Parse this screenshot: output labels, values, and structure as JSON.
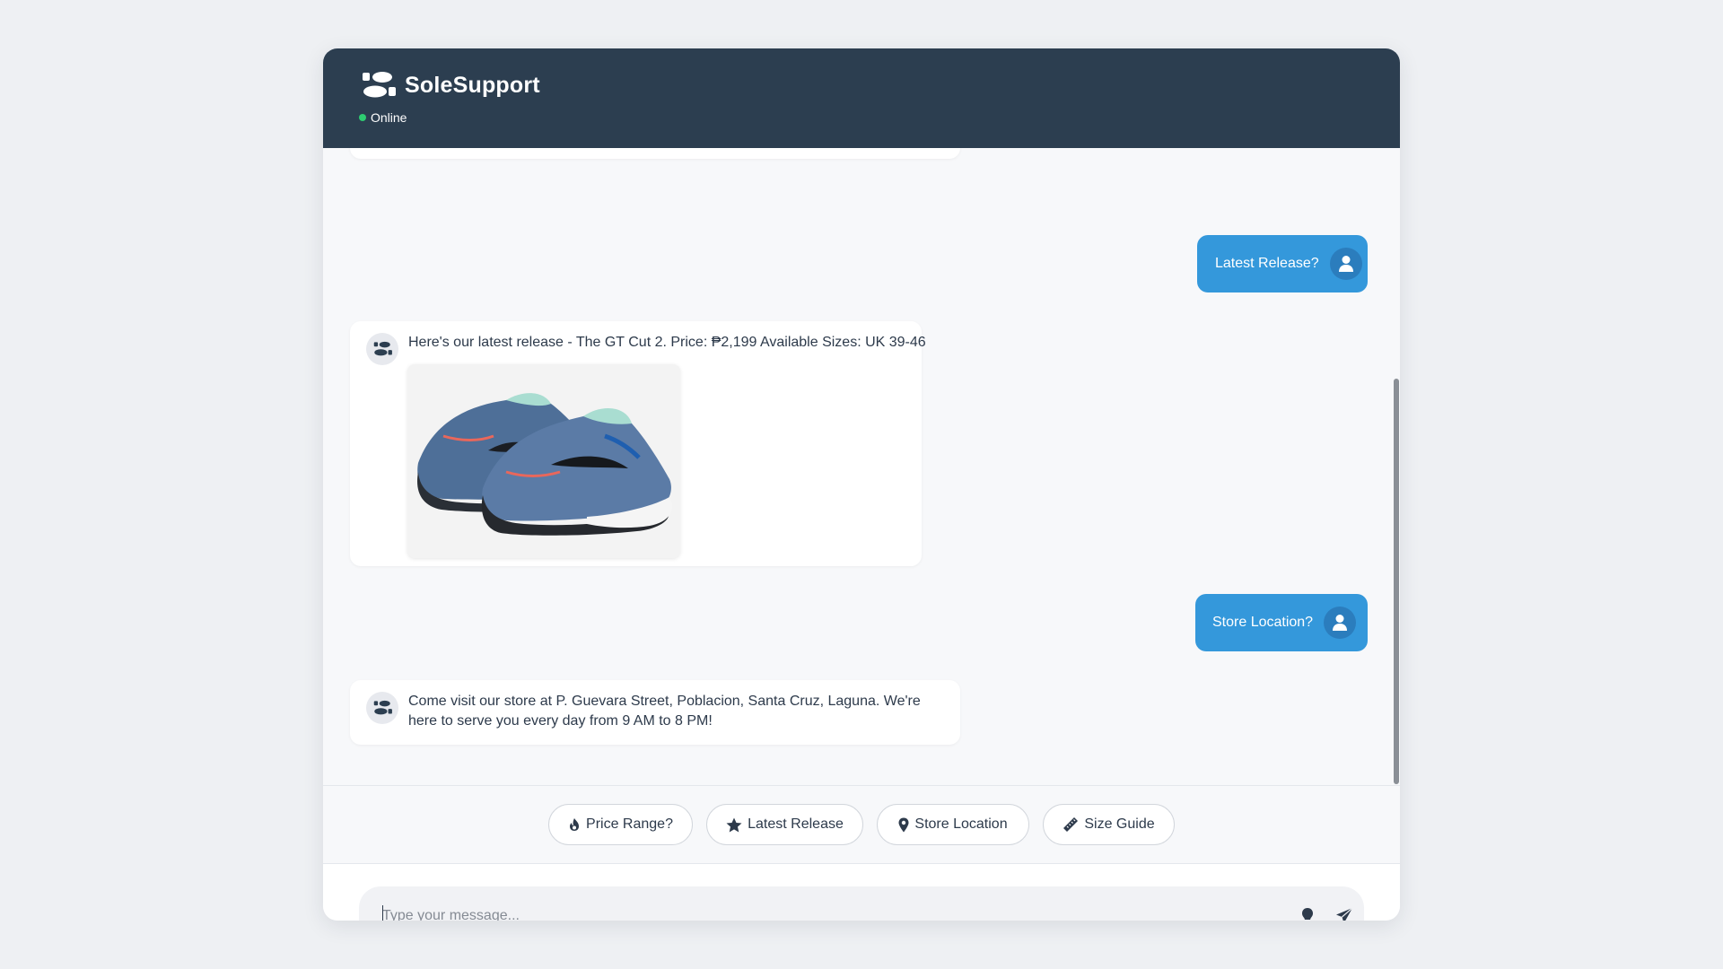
{
  "header": {
    "brand": "SoleSupport",
    "status": "Online",
    "logo_icon": "shoe-prints-icon"
  },
  "messages": [
    {
      "sender": "user",
      "text": "Latest Release?"
    },
    {
      "sender": "bot",
      "text": "Here's our latest release - The GT Cut 2. Price: ₱2,199 Available Sizes: UK 39-46",
      "image": "GT Cut 2 sneakers"
    },
    {
      "sender": "user",
      "text": "Store Location?"
    },
    {
      "sender": "bot",
      "text": "Come visit our store at P. Guevara Street, Poblacion, Santa Cruz, Laguna. We're here to serve you every day from 9 AM to 8 PM!"
    }
  ],
  "quick_replies": [
    {
      "label": "Price Range?",
      "icon": "fire-icon"
    },
    {
      "label": "Latest Release",
      "icon": "star-icon"
    },
    {
      "label": "Store Location",
      "icon": "map-pin-icon"
    },
    {
      "label": "Size Guide",
      "icon": "ruler-icon"
    }
  ],
  "composer": {
    "placeholder": "Type your message...",
    "hint_icon": "lightbulb-icon",
    "send_icon": "paper-plane-icon"
  },
  "colors": {
    "header_bg": "#2c3e50",
    "user_bubble": "#3498db",
    "online": "#2ecc71",
    "page_bg": "#eef0f3"
  }
}
